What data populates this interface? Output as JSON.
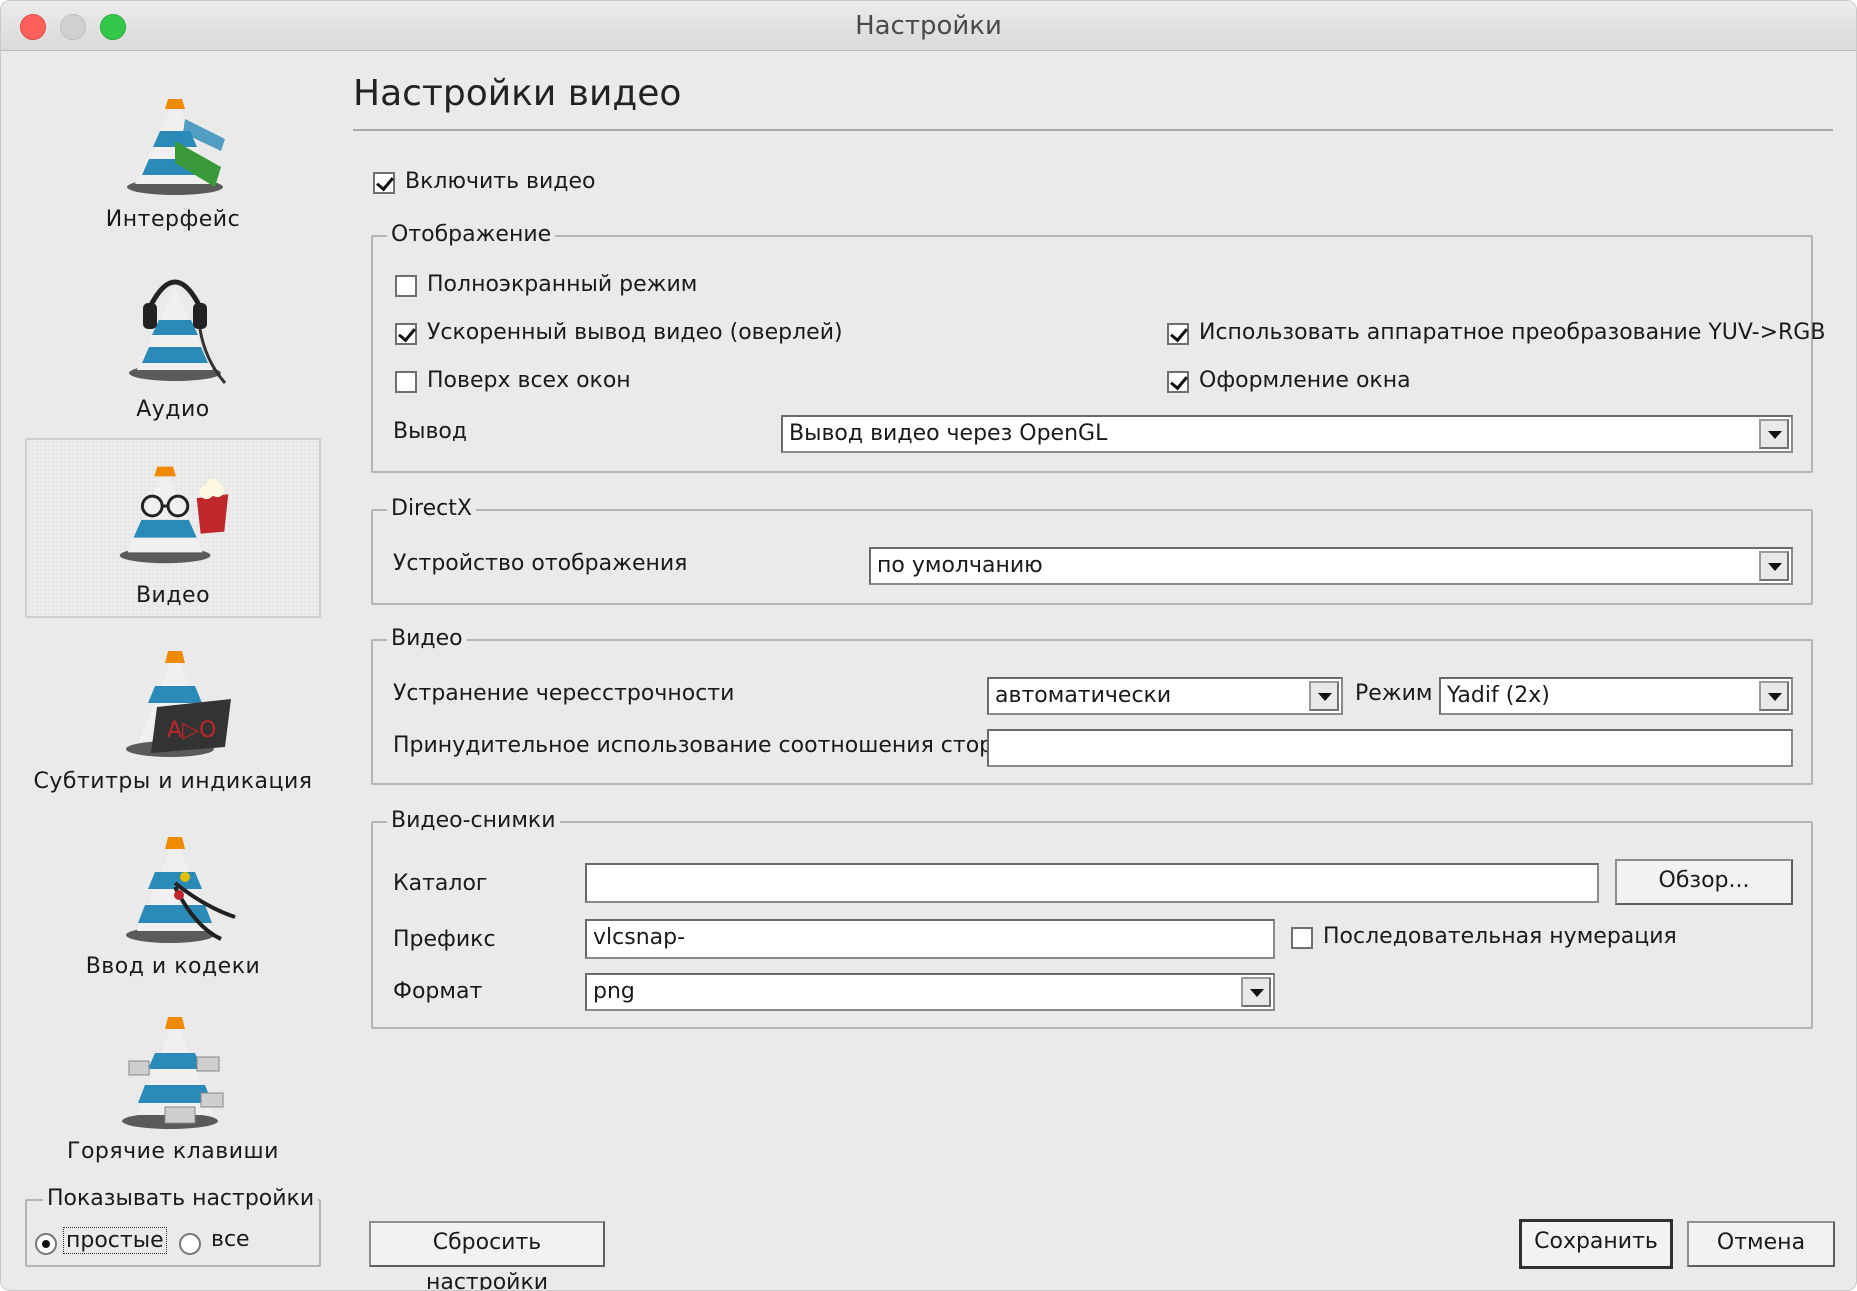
{
  "window": {
    "title": "Настройки"
  },
  "sidebar": {
    "items": [
      {
        "label": "Интерфейс",
        "icon": "vlc-cone-interface-icon"
      },
      {
        "label": "Аудио",
        "icon": "vlc-cone-headphones-icon"
      },
      {
        "label": "Видео",
        "icon": "vlc-cone-video-icon",
        "selected": true
      },
      {
        "label": "Субтитры и индикация",
        "icon": "vlc-cone-subtitles-icon"
      },
      {
        "label": "Ввод и кодеки",
        "icon": "vlc-cone-cables-icon"
      },
      {
        "label": "Горячие клавиши",
        "icon": "vlc-cone-keyboard-icon"
      }
    ],
    "show_settings": {
      "title": "Показывать настройки",
      "options": [
        "простые",
        "все"
      ],
      "selected": "простые"
    }
  },
  "main": {
    "title": "Настройки видео",
    "enable_video": {
      "label": "Включить видео",
      "checked": true
    },
    "display": {
      "title": "Отображение",
      "fullscreen": {
        "label": "Полноэкранный режим",
        "checked": false
      },
      "overlay": {
        "label": "Ускоренный вывод видео (оверлей)",
        "checked": true
      },
      "yuv": {
        "label": "Использовать аппаратное преобразование YUV->RGB",
        "checked": true
      },
      "on_top": {
        "label": "Поверх всех окон",
        "checked": false
      },
      "decorations": {
        "label": "Оформление окна",
        "checked": true
      },
      "output_label": "Вывод",
      "output_value": "Вывод видео через OpenGL"
    },
    "directx": {
      "title": "DirectX",
      "device_label": "Устройство отображения",
      "device_value": "по умолчанию"
    },
    "video": {
      "title": "Видео",
      "deinterlace_label": "Устранение чересстрочности",
      "deinterlace_value": "автоматически",
      "mode_label": "Режим",
      "mode_value": "Yadif (2x)",
      "aspect_label": "Принудительное использование соотношения сторон",
      "aspect_value": ""
    },
    "snapshots": {
      "title": "Видео-снимки",
      "dir_label": "Каталог",
      "dir_value": "",
      "browse_label": "Обзор...",
      "prefix_label": "Префикс",
      "prefix_value": "vlcsnap-",
      "sequential": {
        "label": "Последовательная нумерация",
        "checked": false
      },
      "format_label": "Формат",
      "format_value": "png"
    }
  },
  "footer": {
    "reset_label": "Сбросить настройки",
    "save_label": "Сохранить",
    "cancel_label": "Отмена"
  }
}
